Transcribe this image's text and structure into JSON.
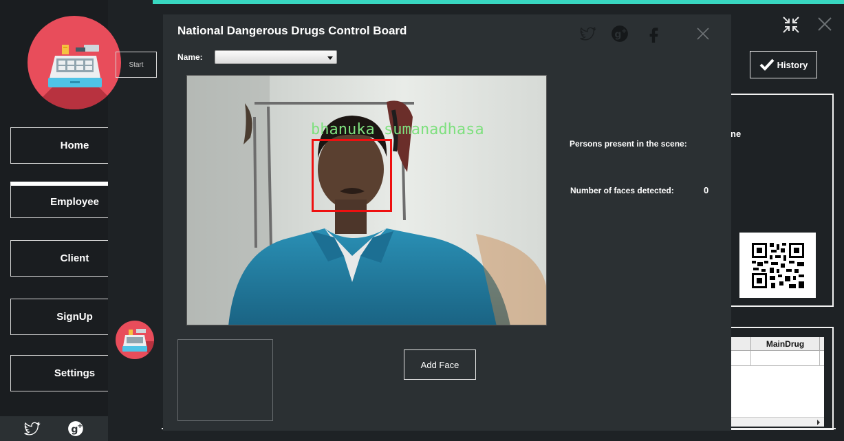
{
  "nav": {
    "items": [
      {
        "label": "Home"
      },
      {
        "label": "Employee"
      },
      {
        "label": "Client"
      },
      {
        "label": "SignUp"
      },
      {
        "label": "Settings"
      }
    ]
  },
  "background": {
    "start_label": "Start",
    "history_label": "History",
    "partial_text": "ne",
    "grid_header": "MainDrug"
  },
  "modal": {
    "title": "National Dangerous Drugs Control Board",
    "name_label": "Name:",
    "name_value": "",
    "face_label": "bhanuka sumanadhasa",
    "persons_label": "Persons present in the scene:",
    "faces_label": "Number of faces detected:",
    "faces_count": "0",
    "add_face_label": "Add Face"
  },
  "icons": [
    "twitter-icon",
    "google-plus-icon",
    "facebook-icon",
    "close-icon",
    "minimize-icon",
    "checkmark-icon"
  ],
  "colors": {
    "accent": "#38d7c0",
    "logo": "#e84d5b",
    "face_box": "#ee1010",
    "face_label": "#7fe07f",
    "modal_bg": "#2b3033",
    "sidebar_bg": "#1a1d20"
  }
}
